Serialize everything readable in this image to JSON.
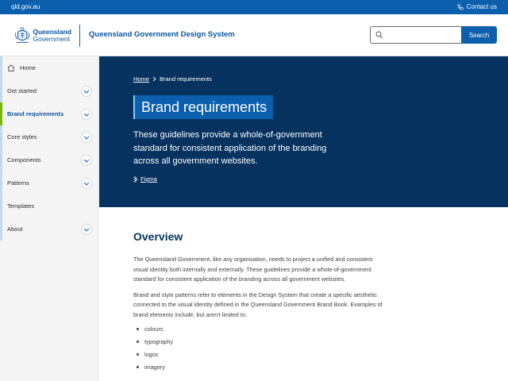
{
  "topbar": {
    "site_link": "qld.gov.au",
    "contact_label": "Contact us"
  },
  "header": {
    "logo_line1": "Queensland",
    "logo_line2": "Government",
    "site_title": "Queensland Government Design System",
    "search_placeholder": "",
    "search_button": "Search"
  },
  "sidebar": {
    "items": [
      {
        "label": "Home",
        "icon": "home-icon"
      },
      {
        "label": "Get started",
        "icon": "chevron-down-icon"
      },
      {
        "label": "Brand requirements",
        "icon": "chevron-down-icon"
      },
      {
        "label": "Core styles",
        "icon": "chevron-down-icon"
      },
      {
        "label": "Components",
        "icon": "chevron-down-icon"
      },
      {
        "label": "Patterns",
        "icon": "chevron-down-icon"
      },
      {
        "label": "Templates"
      },
      {
        "label": "About",
        "icon": "chevron-down-icon"
      }
    ],
    "active_index": 2
  },
  "hero": {
    "breadcrumb_home": "Home",
    "breadcrumb_current": "Brand requirements",
    "title": "Brand requirements",
    "description": "These guidelines provide a whole-of-government standard for consistent application of the branding across all government websites.",
    "figma_link": "Figma"
  },
  "content": {
    "heading": "Overview",
    "para1": "The Queensland Government, like any organisation, needs to project a unified and consistent visual identity both internally and externally. These guidelines provide a whole-of-government standard for consistent application of the branding across all government websites.",
    "para2": "Brand and style patterns refer to elements in the Design System that create a specific aesthetic connected to the visual identity defined in the Queensland Government Brand Book. Examples of brand elements include, but aren't limited to:",
    "list": [
      "colours",
      "typography",
      "logos",
      "imagery"
    ]
  },
  "colors": {
    "topbar": "#0b5fad",
    "hero": "#05325f",
    "accent_green": "#78ba00",
    "title_bg": "#0b5fad"
  }
}
